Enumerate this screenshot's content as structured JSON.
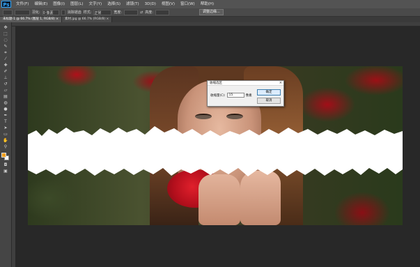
{
  "app": {
    "logo": "Ps"
  },
  "menu": [
    "文件(F)",
    "编辑(E)",
    "图像(I)",
    "图层(L)",
    "文字(Y)",
    "选择(S)",
    "滤镜(T)",
    "3D(D)",
    "视图(V)",
    "窗口(W)",
    "帮助(H)"
  ],
  "options": {
    "feather_label": "羽化:",
    "feather_value": "0 像素",
    "antialias_label": "消除锯齿",
    "style_label": "样式:",
    "style_value": "正常",
    "width_label": "宽度:",
    "height_label": "高度:",
    "refine_button": "调整边缘..."
  },
  "tabs": [
    {
      "label": "未标题-1 @ 66.7% (图层 1, RGB/8) ×"
    },
    {
      "label": "素材.jpg @ 66.7% (RGB/8) ×"
    }
  ],
  "dialog": {
    "title": "收缩选区",
    "close_glyph": "×",
    "label": "收缩量(C):",
    "value": "15",
    "unit": "像素",
    "ok": "确定",
    "cancel": "取消"
  },
  "colors": {
    "foreground": "#f2a01d",
    "background": "#ffffff"
  },
  "tools": [
    "move-icon",
    "marquee-icon",
    "lasso-icon",
    "quick-select-icon",
    "crop-icon",
    "eyedropper-icon",
    "healing-icon",
    "brush-icon",
    "stamp-icon",
    "history-brush-icon",
    "eraser-icon",
    "gradient-icon",
    "blur-icon",
    "dodge-icon",
    "pen-icon",
    "type-icon",
    "path-select-icon",
    "shape-icon",
    "hand-icon",
    "zoom-icon"
  ]
}
